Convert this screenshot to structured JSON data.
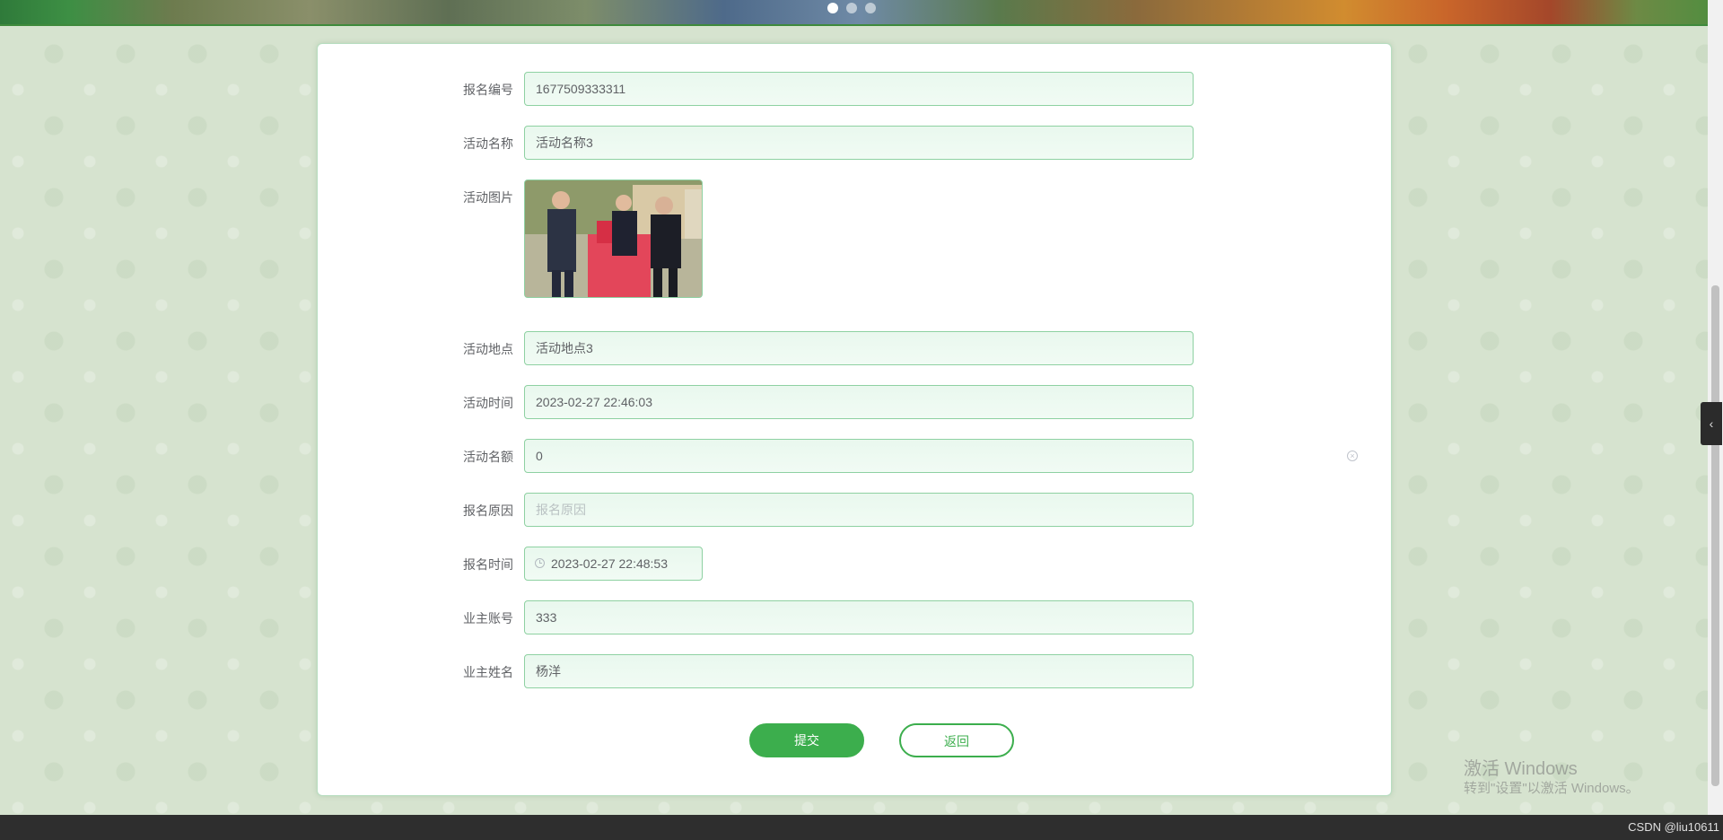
{
  "banner": {
    "slides": 3,
    "active_slide": 1
  },
  "form": {
    "fields": [
      {
        "label": "报名编号",
        "value": "1677509333311",
        "placeholder": "报名编号"
      },
      {
        "label": "活动名称",
        "value": "活动名称3",
        "placeholder": "活动名称"
      },
      {
        "label": "活动图片"
      },
      {
        "label": "活动地点",
        "value": "活动地点3",
        "placeholder": "活动地点"
      },
      {
        "label": "活动时间",
        "value": "2023-02-27 22:46:03",
        "placeholder": "活动时间"
      },
      {
        "label": "活动名额",
        "value": "0",
        "placeholder": "活动名额"
      },
      {
        "label": "报名原因",
        "value": "",
        "placeholder": "报名原因"
      },
      {
        "label": "报名时间",
        "value": "2023-02-27 22:48:53",
        "placeholder": "报名时间"
      },
      {
        "label": "业主账号",
        "value": "333",
        "placeholder": "业主账号"
      },
      {
        "label": "业主姓名",
        "value": "杨洋",
        "placeholder": "业主姓名"
      }
    ],
    "submit_label": "提交",
    "back_label": "返回"
  },
  "side_tab": {
    "icon": "chevron-left-icon",
    "glyph": "‹"
  },
  "watermark": {
    "title": "激活 Windows",
    "subtitle": "转到\"设置\"以激活 Windows。"
  },
  "footer": {
    "credit": "CSDN @liu10611"
  },
  "colors": {
    "accent": "#3cae4d",
    "input_border": "#8ed1a2",
    "input_bg": "#e9f8ee"
  }
}
